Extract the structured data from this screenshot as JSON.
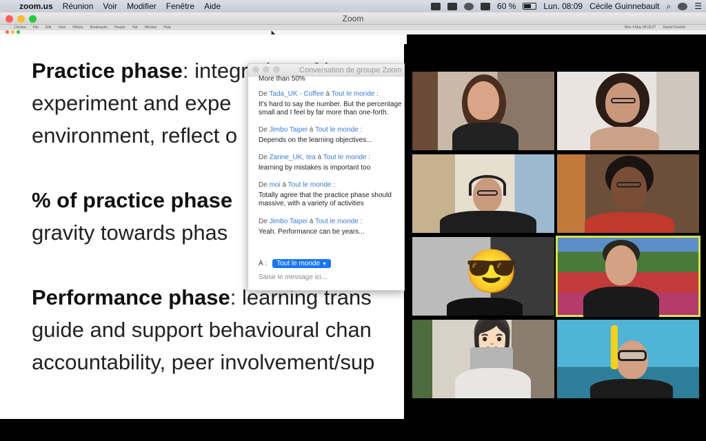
{
  "menubar": {
    "app_name": "zoom.us",
    "menus": [
      "Réunion",
      "Voir",
      "Modifier",
      "Fenêtre",
      "Aide"
    ],
    "battery": "60 %",
    "clock": "Lun. 08:09",
    "user": "Cécile Guinnebault"
  },
  "window": {
    "title": "Zoom"
  },
  "remote_menubar": {
    "items": [
      "Chrome",
      "File",
      "Edit",
      "View",
      "History",
      "Bookmarks",
      "People",
      "Tab",
      "Window",
      "Help"
    ],
    "clock": "Mon 4 May 08:09:27",
    "user": "Daniel Penfold"
  },
  "slide": {
    "line1_bold": "Practice phase",
    "line1_rest": ": integration of l",
    "line2": "experiment and expe",
    "line3": "environment, reflect o",
    "line4_bold": "% of practice phase",
    "line5": "gravity towards phas",
    "line6_bold": "Performance phase",
    "line6_rest": ": learning trans",
    "line7": "guide and support behavioural chan",
    "line8": "accountability, peer involvement/sup"
  },
  "chat": {
    "title": "Conversation de groupe Zoom",
    "top_partial": "More than 50%",
    "messages": [
      {
        "prefix": "De",
        "sender": "Tada_UK - Coffee",
        "to_word": "à",
        "recipient": "Tout le monde",
        "colon": ":",
        "lines": [
          "It's hard to say the number. But the percentage",
          "small and I feel by far more than one-forth."
        ]
      },
      {
        "prefix": "De",
        "sender": "Jimbo Taipei",
        "to_word": "à",
        "recipient": "Tout le monde",
        "colon": ":",
        "lines": [
          "Depends on the learning objectives..."
        ]
      },
      {
        "prefix": "De",
        "sender": "Zarine_UK, tea",
        "to_word": "à",
        "recipient": "Tout le monde",
        "colon": ":",
        "lines": [
          "learning by mistakes is important too"
        ]
      },
      {
        "prefix": "De",
        "sender": "moi",
        "to_word": "à",
        "recipient": "Tout le monde",
        "colon": ":",
        "lines": [
          "Totally agree that the practice phase should",
          "massive, with a variety of activities"
        ]
      },
      {
        "prefix": "De",
        "sender": "Jimbo Taipei",
        "to_word": "à",
        "recipient": "Tout le monde",
        "colon": ":",
        "lines": [
          "Yeah. Performance can be years..."
        ]
      }
    ],
    "to_label": "À :",
    "to_value": "Tout le monde",
    "input_placeholder": "Saisir le message ici..."
  },
  "emojis": {
    "sunglasses": "😎",
    "woman": "👩🏻"
  },
  "colors": {
    "accent": "#1877f2",
    "link": "#3a7bd5",
    "active_speaker": "#d7e34c"
  }
}
